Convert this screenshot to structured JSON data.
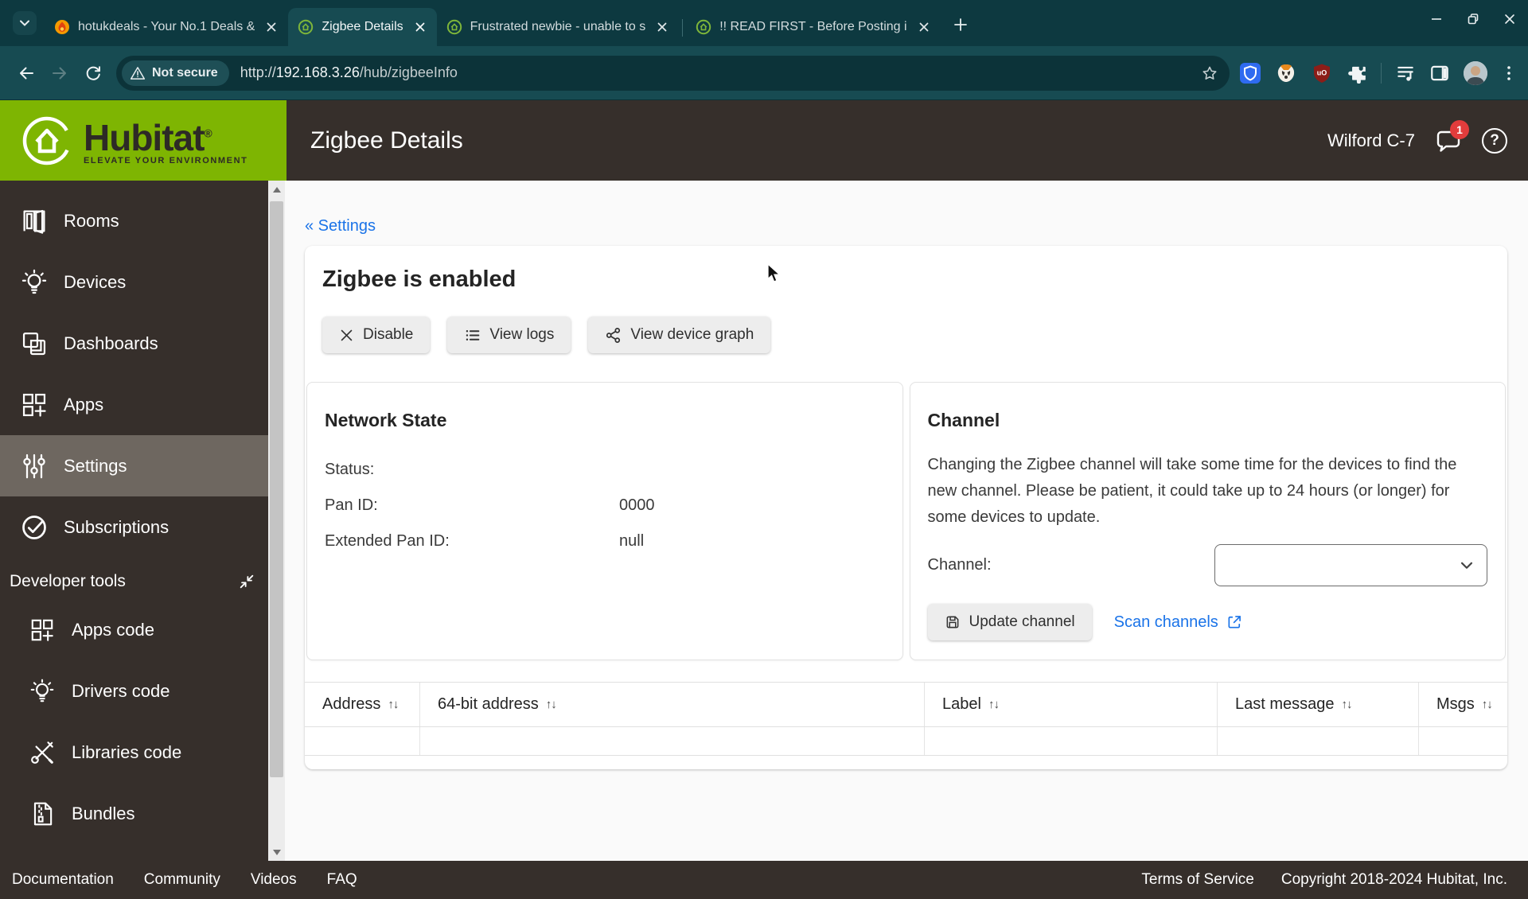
{
  "colors": {
    "accent_green": "#7eb502",
    "header_brown": "#362f2b",
    "sidebar_selected": "#6e6760",
    "chrome_teal_dark": "#0d3940",
    "chrome_teal": "#174b52",
    "link_blue": "#1a73e8",
    "badge_red": "#e23c3c",
    "content_bg": "#fafafa"
  },
  "browser": {
    "tabs": [
      {
        "title": "hotukdeals - Your No.1 Deals &",
        "favicon": "hotukdeals-flame-icon"
      },
      {
        "title": "Zigbee Details",
        "favicon": "hubitat-icon",
        "active": true
      },
      {
        "title": "Frustrated newbie - unable to s",
        "favicon": "hubitat-icon"
      },
      {
        "title": "!! READ FIRST - Before Posting i",
        "favicon": "hubitat-icon"
      }
    ],
    "security_chip": "Not secure",
    "url": {
      "scheme": "http://",
      "host": "192.168.3.26",
      "path": "/hub/zigbeeInfo"
    }
  },
  "header": {
    "brand": "Hubitat",
    "reg": "®",
    "tagline": "ELEVATE YOUR ENVIRONMENT",
    "page_title": "Zigbee Details",
    "hub_name": "Wilford C-7",
    "notification_count": "1",
    "help_glyph": "?"
  },
  "sidebar": {
    "items": [
      {
        "label": "Rooms",
        "icon": "rooms-icon"
      },
      {
        "label": "Devices",
        "icon": "bulb-icon"
      },
      {
        "label": "Dashboards",
        "icon": "dashboards-icon"
      },
      {
        "label": "Apps",
        "icon": "apps-grid-icon"
      },
      {
        "label": "Settings",
        "icon": "sliders-icon",
        "active": true
      },
      {
        "label": "Subscriptions",
        "icon": "check-circle-icon"
      }
    ],
    "developer_section": {
      "label": "Developer tools",
      "icon": "collapse-icon"
    },
    "developer_items": [
      {
        "label": "Apps code",
        "icon": "apps-grid-icon"
      },
      {
        "label": "Drivers code",
        "icon": "bulb-icon"
      },
      {
        "label": "Libraries code",
        "icon": "tools-icon"
      },
      {
        "label": "Bundles",
        "icon": "zip-file-icon"
      }
    ]
  },
  "main": {
    "breadcrumb": "« Settings",
    "status_heading": "Zigbee is enabled",
    "actions": [
      {
        "label": "Disable",
        "icon": "x-icon"
      },
      {
        "label": "View logs",
        "icon": "list-icon"
      },
      {
        "label": "View device graph",
        "icon": "share-icon"
      }
    ],
    "network_state": {
      "title": "Network State",
      "rows": [
        {
          "label": "Status:",
          "value": ""
        },
        {
          "label": "Pan ID:",
          "value": "0000"
        },
        {
          "label": "Extended Pan ID:",
          "value": "null"
        }
      ]
    },
    "channel": {
      "title": "Channel",
      "description": "Changing the Zigbee channel will take some time for the devices to find the new channel. Please be patient, it could take up to 24 hours (or longer) for some devices to update.",
      "select_label": "Channel:",
      "select_value": "",
      "update_button": "Update channel",
      "scan_link": "Scan channels"
    },
    "table": {
      "columns": [
        "Address",
        "64-bit address",
        "Label",
        "Last message",
        "Msgs"
      ]
    }
  },
  "footer": {
    "links": [
      "Documentation",
      "Community",
      "Videos",
      "FAQ"
    ],
    "terms": "Terms of Service",
    "copyright": "Copyright 2018-2024 Hubitat, Inc."
  },
  "glyphs": {
    "sort": "↑↓",
    "question": "?"
  }
}
